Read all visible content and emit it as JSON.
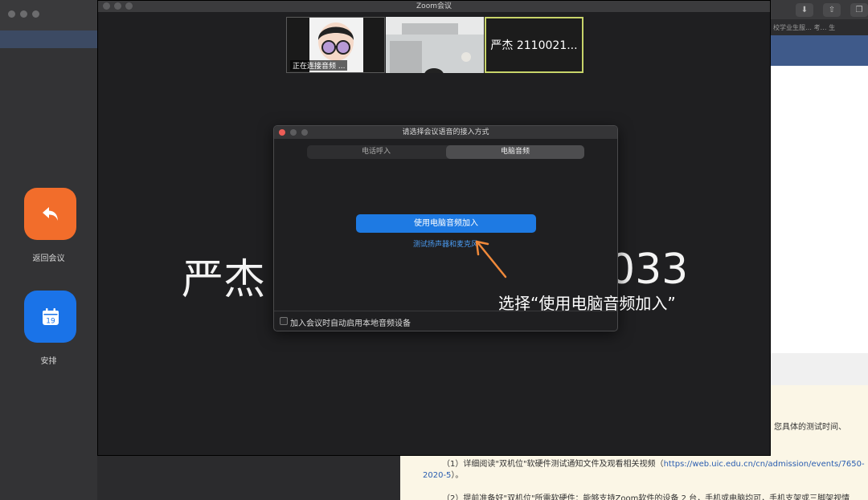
{
  "background_left": {
    "buttons": [
      {
        "label": "返回会议",
        "icon": "return-arrow-icon",
        "color": "#f26d2b"
      },
      {
        "label": "安排",
        "icon": "calendar-icon",
        "icon_text": "19",
        "color": "#1a73e8"
      }
    ]
  },
  "background_right": {
    "tab_text": "校学业生服… 考… 生",
    "doc_lines": {
      "line0": "您具体的测试时间、",
      "line1_prefix": "（1）详细阅读\"双机位\"软硬件测试通知文件及观看相关视频（",
      "line1_link": "https://web.uic.edu.cn/cn/admission/events/7650-",
      "line2_link": "2020-5",
      "line2_suffix": "）。",
      "line3": "（2）提前准备好\"双机位\"所需软硬件：能够支持Zoom软件的设备 2 台，手机或电脑均可，手机支架或三脚架视情"
    }
  },
  "zoom_window": {
    "title": "Zoom会议",
    "tiles": [
      {
        "caption": "正在连接音频 ..."
      },
      {
        "caption": ""
      },
      {
        "name": "严杰 2110021..."
      }
    ],
    "big_name_left": "严杰",
    "big_name_right": "033"
  },
  "dialog": {
    "title": "请选择会议语音的接入方式",
    "tabs": [
      {
        "label": "电话呼入",
        "active": false
      },
      {
        "label": "电脑音频",
        "active": true
      }
    ],
    "join_button": "使用电脑音频加入",
    "test_link": "测试扬声器和麦克风",
    "checkbox_label": "加入会议时自动启用本地音频设备",
    "checkbox_checked": false
  },
  "annotation": {
    "text": "选择“使用电脑音频加入”",
    "arrow_color": "#f0893a"
  }
}
